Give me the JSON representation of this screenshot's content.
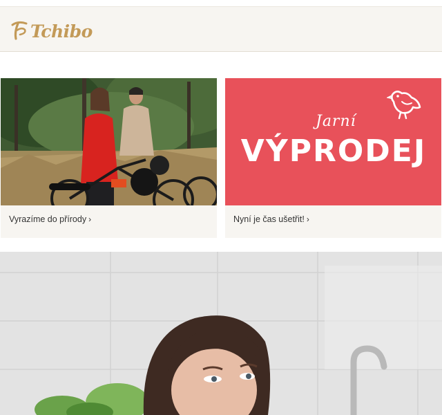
{
  "header": {
    "logo_text": "Tchibo"
  },
  "promo_cards": [
    {
      "caption": "Vyrazíme do přírody",
      "chevron": "›"
    },
    {
      "caption": "Nyní je čas ušetřit!",
      "chevron": "›",
      "banner_script": "Jarní",
      "banner_title": "VÝPRODEJ"
    }
  ],
  "colors": {
    "brand_gold": "#c39a58",
    "sale_red": "#e8515a",
    "header_bg": "#f7f5f1"
  },
  "icons": [
    "tchibo-logo-icon",
    "bird-icon",
    "chevron-right-icon"
  ]
}
